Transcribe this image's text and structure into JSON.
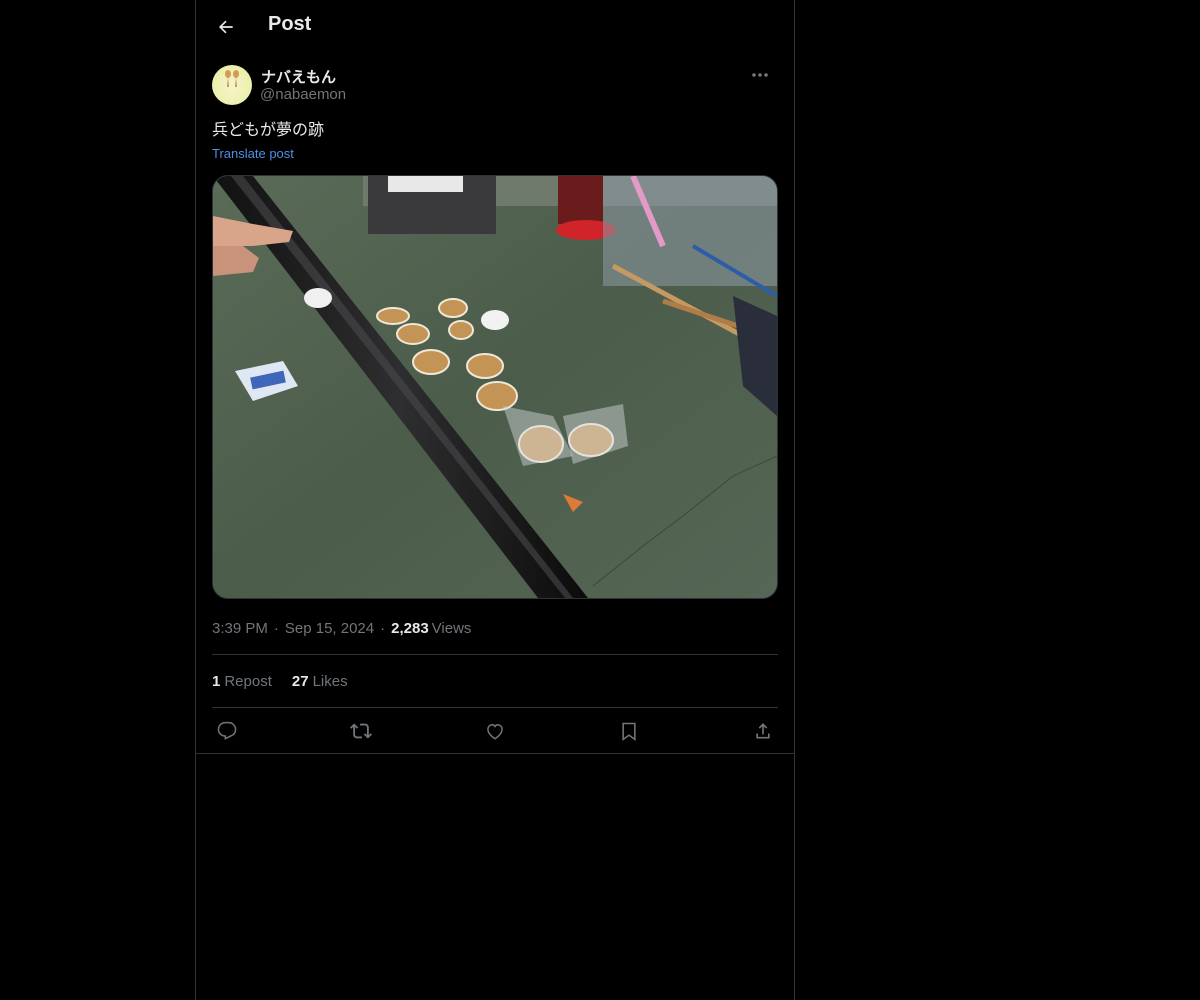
{
  "header": {
    "back_icon": "arrow-left-icon",
    "title": "Post"
  },
  "post": {
    "author": {
      "display_name": "ナバえもん",
      "handle": "@nabaemon",
      "avatar_icon": "avatar-figure"
    },
    "more_icon": "ellipsis-icon",
    "text": "兵どもが夢の跡",
    "translate_label": "Translate post",
    "media": {
      "description_icon": "photo"
    },
    "meta": {
      "time": "3:39 PM",
      "separator": "·",
      "date": "Sep 15, 2024",
      "views_count": "2,283",
      "views_label": "Views"
    },
    "stats": {
      "reposts_count": "1",
      "reposts_label": "Repost",
      "likes_count": "27",
      "likes_label": "Likes"
    },
    "actions": [
      "reply-icon",
      "repost-icon",
      "like-icon",
      "bookmark-icon",
      "share-icon"
    ]
  },
  "colors": {
    "background": "#000000",
    "text_primary": "#e7e9ea",
    "text_secondary": "#71767b",
    "link": "#4f8fe0",
    "border": "#2f3336"
  }
}
